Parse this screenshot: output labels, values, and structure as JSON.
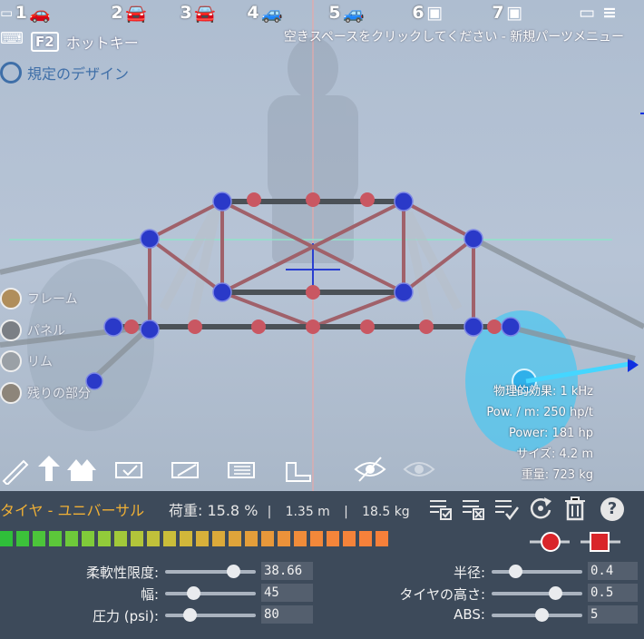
{
  "top_bar": {
    "slots": [
      "1",
      "2",
      "3",
      "4",
      "5",
      "6",
      "7"
    ],
    "hint": "空きスペースをクリックしてください - 新規パーツメニュー"
  },
  "hotkey": {
    "key": "F2",
    "label": "ホットキー"
  },
  "design": {
    "label": "規定のデザイン"
  },
  "layers": [
    "フレーム",
    "パネル",
    "リム",
    "残りの部分"
  ],
  "stats": {
    "physics": "物理的効果: 1 kHz",
    "pow_m": "Pow. / m: 250 hp/t",
    "power": "Power: 181 hp",
    "size": "サイズ: 4.2 m",
    "weight": "重量: 723 kg"
  },
  "part": {
    "title": "タイヤ - ユニバーサル",
    "load": "荷重: 15.8 %",
    "sep1": "|",
    "dim": "1.35 m",
    "sep2": "|",
    "mass": "18.5 kg"
  },
  "params": {
    "flex": {
      "label": "柔軟性限度:",
      "value": "38.66"
    },
    "width": {
      "label": "幅:",
      "value": "45"
    },
    "pressure": {
      "label": "圧力 (psi):",
      "value": "80"
    },
    "radius": {
      "label": "半径:",
      "value": "0.4"
    },
    "tire_height": {
      "label": "タイヤの高さ:",
      "value": "0.5"
    },
    "abs": {
      "label": "ABS:",
      "value": "5"
    }
  },
  "help_label": "?",
  "colors": {
    "panel": "#3d4a5a",
    "accent": "#f0b035",
    "knob_red": "#d9252a"
  }
}
